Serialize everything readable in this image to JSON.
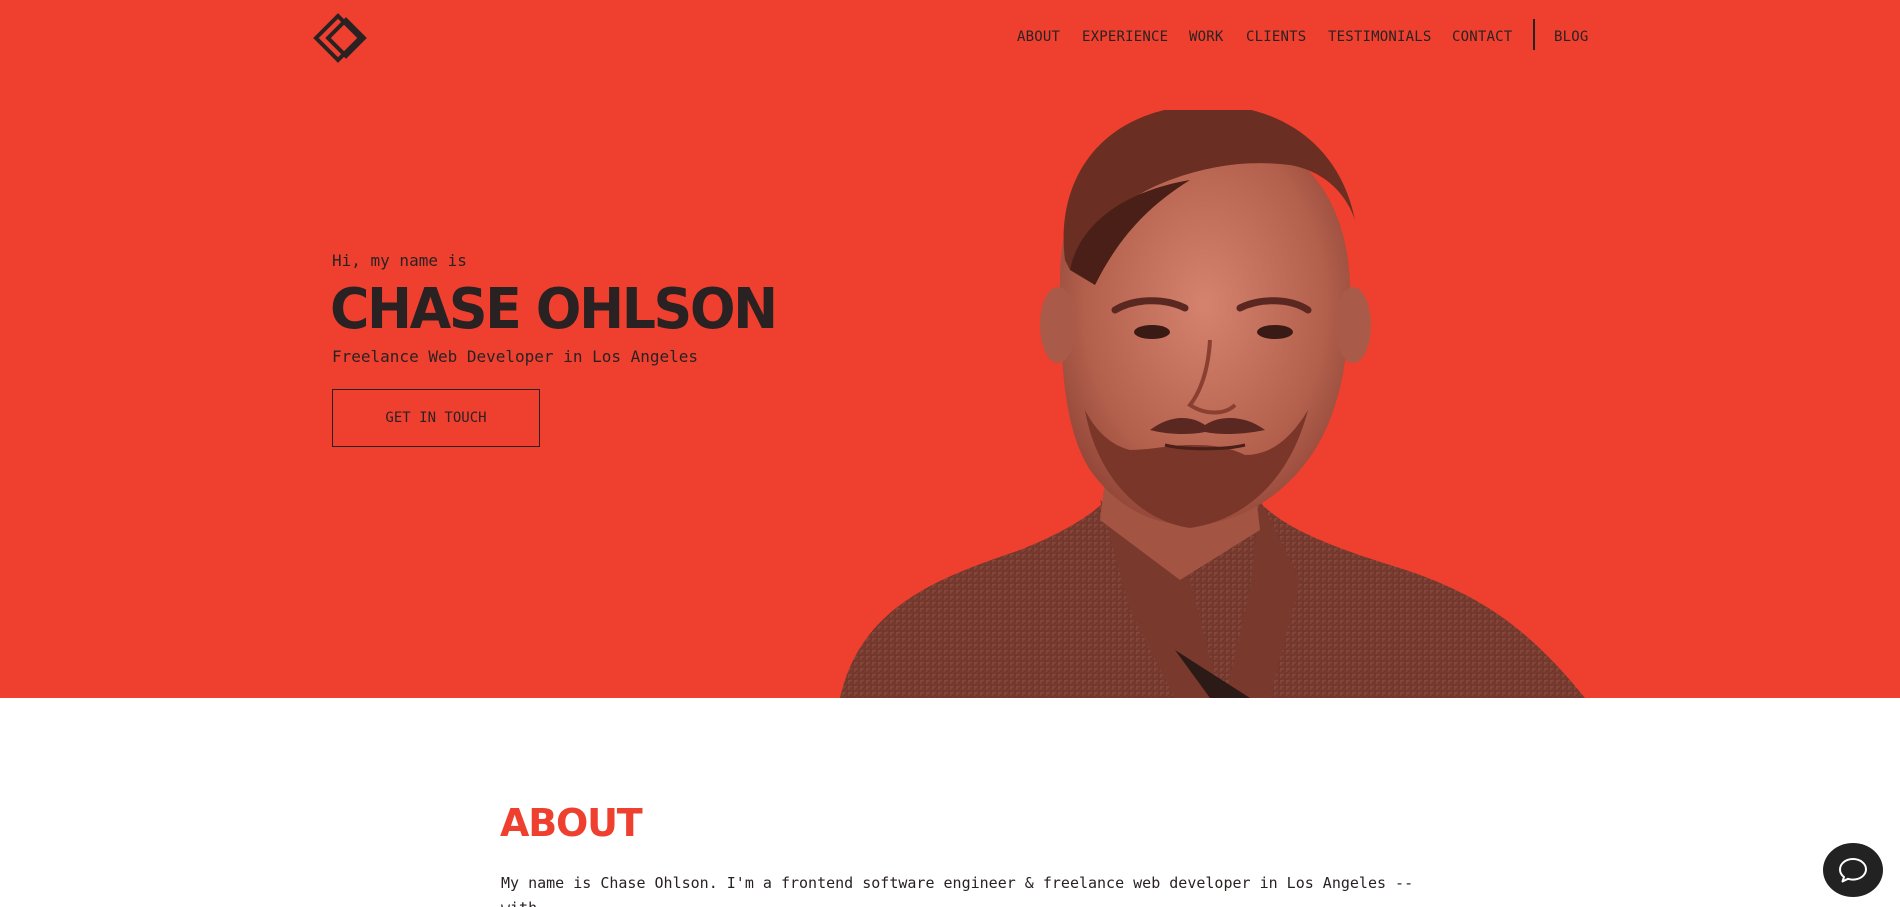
{
  "brand": {
    "logo_icon": "diamond-logo-icon"
  },
  "nav": {
    "items": [
      {
        "label": "ABOUT"
      },
      {
        "label": "EXPERIENCE"
      },
      {
        "label": "WORK"
      },
      {
        "label": "CLIENTS"
      },
      {
        "label": "TESTIMONIALS"
      },
      {
        "label": "CONTACT"
      },
      {
        "label": "BLOG"
      }
    ]
  },
  "hero": {
    "greeting": "Hi, my name is",
    "name": "CHASE OHLSON",
    "tagline": "Freelance Web Developer in Los Angeles",
    "cta_label": "GET IN TOUCH",
    "background_color": "#ef402f"
  },
  "about": {
    "title": "ABOUT",
    "text": "My name is Chase Ohlson. I'm a frontend software engineer & freelance web developer in Los Angeles -- with"
  },
  "chat": {
    "icon": "chat-bubble-icon"
  },
  "colors": {
    "accent": "#ef402f",
    "text_dark": "#2a2222",
    "chat_button": "#222222"
  }
}
